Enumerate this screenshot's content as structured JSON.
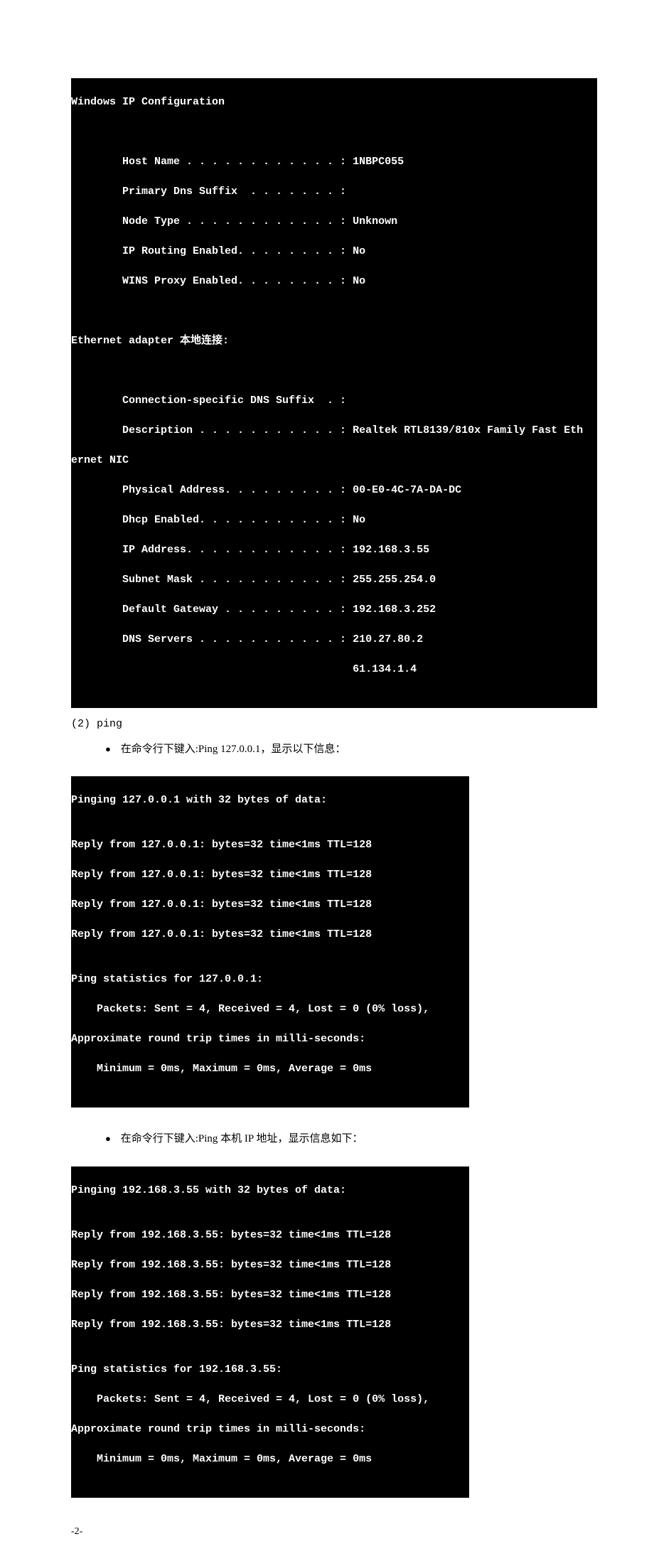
{
  "ipconfig": {
    "header": "Windows IP Configuration",
    "host_name": "        Host Name . . . . . . . . . . . . : 1NBPC055",
    "dns_suffix": "        Primary Dns Suffix  . . . . . . . :",
    "node_type": "        Node Type . . . . . . . . . . . . : Unknown",
    "ip_routing": "        IP Routing Enabled. . . . . . . . : No",
    "wins_proxy": "        WINS Proxy Enabled. . . . . . . . : No",
    "adapter_header": "Ethernet adapter 本地连接:",
    "conn_dns": "        Connection-specific DNS Suffix  . :",
    "description": "        Description . . . . . . . . . . . : Realtek RTL8139/810x Family Fast Eth",
    "desc_wrap": "ernet NIC",
    "phys_addr": "        Physical Address. . . . . . . . . : 00-E0-4C-7A-DA-DC",
    "dhcp": "        Dhcp Enabled. . . . . . . . . . . : No",
    "ip_addr": "        IP Address. . . . . . . . . . . . : 192.168.3.55",
    "subnet": "        Subnet Mask . . . . . . . . . . . : 255.255.254.0",
    "gateway": "        Default Gateway . . . . . . . . . : 192.168.3.252",
    "dns1": "        DNS Servers . . . . . . . . . . . : 210.27.80.2",
    "dns2": "                                            61.134.1.4"
  },
  "section2": {
    "heading": "(2)  ping",
    "bullet1": "在命令行下键入:Ping 127.0.0.1，显示以下信息：",
    "bullet2": "在命令行下键入:Ping 本机 IP 地址，显示信息如下："
  },
  "ping1": {
    "l1": "Pinging 127.0.0.1 with 32 bytes of data:",
    "l2": "",
    "l3": "Reply from 127.0.0.1: bytes=32 time<1ms TTL=128",
    "l4": "Reply from 127.0.0.1: bytes=32 time<1ms TTL=128",
    "l5": "Reply from 127.0.0.1: bytes=32 time<1ms TTL=128",
    "l6": "Reply from 127.0.0.1: bytes=32 time<1ms TTL=128",
    "l7": "",
    "l8": "Ping statistics for 127.0.0.1:",
    "l9": "    Packets: Sent = 4, Received = 4, Lost = 0 (0% loss),",
    "l10": "Approximate round trip times in milli-seconds:",
    "l11": "    Minimum = 0ms, Maximum = 0ms, Average = 0ms"
  },
  "ping2": {
    "l1": "Pinging 192.168.3.55 with 32 bytes of data:",
    "l2": "",
    "l3": "Reply from 192.168.3.55: bytes=32 time<1ms TTL=128",
    "l4": "Reply from 192.168.3.55: bytes=32 time<1ms TTL=128",
    "l5": "Reply from 192.168.3.55: bytes=32 time<1ms TTL=128",
    "l6": "Reply from 192.168.3.55: bytes=32 time<1ms TTL=128",
    "l7": "",
    "l8": "Ping statistics for 192.168.3.55:",
    "l9": "    Packets: Sent = 4, Received = 4, Lost = 0 (0% loss),",
    "l10": "Approximate round trip times in milli-seconds:",
    "l11": "    Minimum = 0ms, Maximum = 0ms, Average = 0ms"
  },
  "page_number": "-2-"
}
